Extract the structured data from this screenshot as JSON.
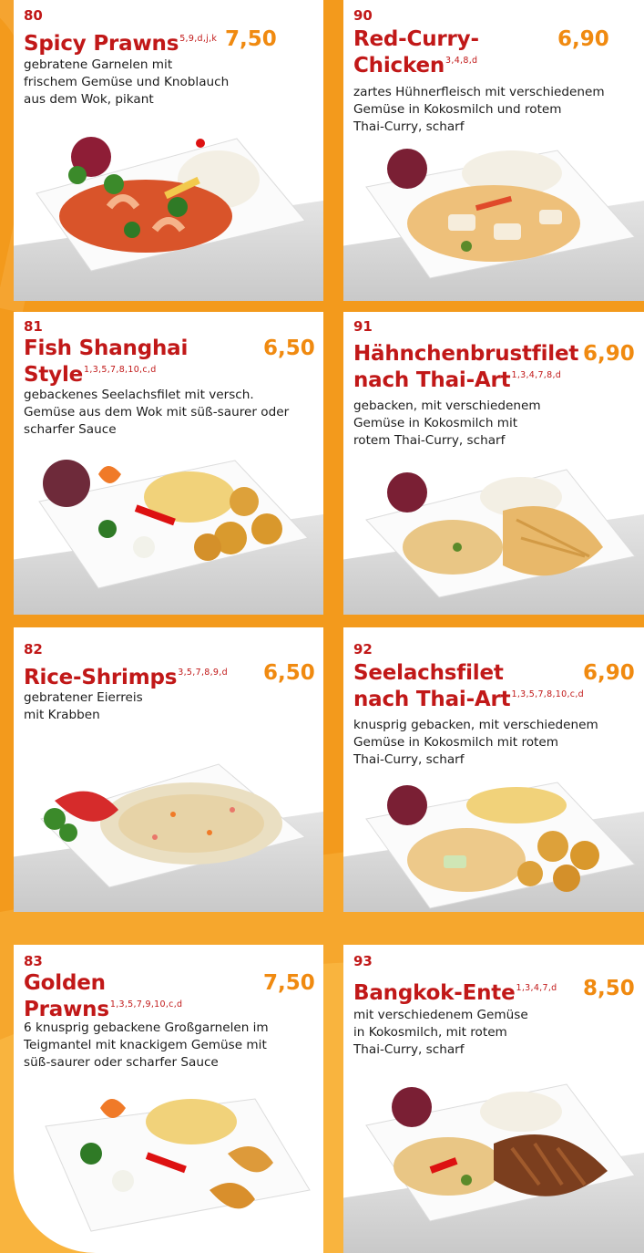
{
  "theme": {
    "background": "#f39a1c",
    "card": "#ffffff",
    "title_color": "#c11818",
    "price_color": "#f08a10",
    "text_color": "#1c1c1c"
  },
  "items": [
    {
      "number": "80",
      "title_lines": [
        "Spicy Prawns"
      ],
      "allergens": "5,9,d,j,k",
      "price": "7,50",
      "description_lines": [
        "gebratene Garnelen mit",
        "frischem Gemüse und Knoblauch",
        "aus dem Wok, pikant"
      ],
      "dish_icon": "prawn-dish-icon"
    },
    {
      "number": "81",
      "title_lines": [
        "Fish Shanghai",
        "Style"
      ],
      "allergens": "1,3,5,7,8,10,c,d",
      "price": "6,50",
      "description_lines": [
        "gebackenes Seelachsfilet mit versch.",
        "Gemüse aus dem Wok mit süß-saurer oder",
        "scharfer Sauce"
      ],
      "dish_icon": "fish-dish-icon"
    },
    {
      "number": "82",
      "title_lines": [
        "Rice-Shrimps"
      ],
      "allergens": "3,5,7,8,9,d",
      "price": "6,50",
      "description_lines": [
        "gebratener Eierreis",
        "mit Krabben"
      ],
      "dish_icon": "fried-rice-dish-icon"
    },
    {
      "number": "83",
      "title_lines": [
        "Golden",
        "Prawns"
      ],
      "allergens": "1,3,5,7,9,10,c,d",
      "price": "7,50",
      "description_lines": [
        "6 knusprig gebackene Großgarnelen im",
        "Teigmantel mit knackigem Gemüse mit",
        "süß-saurer oder scharfer Sauce"
      ],
      "dish_icon": "golden-prawns-dish-icon"
    },
    {
      "number": "90",
      "title_lines": [
        "Red-Curry-",
        "Chicken"
      ],
      "allergens": "3,4,8,d",
      "price": "6,90",
      "description_lines": [
        "zartes Hühnerfleisch mit verschiedenem",
        "Gemüse in Kokosmilch und rotem",
        "Thai-Curry, scharf"
      ],
      "dish_icon": "curry-chicken-dish-icon"
    },
    {
      "number": "91",
      "title_lines": [
        "Hähnchenbrustfilet",
        "nach Thai-Art"
      ],
      "allergens": "1,3,4,7,8,d",
      "price": "6,90",
      "description_lines": [
        "gebacken, mit verschiedenem",
        "Gemüse in Kokosmilch mit",
        "rotem Thai-Curry, scharf"
      ],
      "dish_icon": "chicken-breast-dish-icon"
    },
    {
      "number": "92",
      "title_lines": [
        "Seelachsfilet",
        "nach Thai-Art"
      ],
      "allergens": "1,3,5,7,8,10,c,d",
      "price": "6,90",
      "description_lines": [
        "knusprig gebacken, mit verschiedenem",
        "Gemüse in Kokosmilch mit rotem",
        "Thai-Curry, scharf"
      ],
      "dish_icon": "fish-curry-dish-icon"
    },
    {
      "number": "93",
      "title_lines": [
        "Bangkok-Ente"
      ],
      "allergens": "1,3,4,7,d",
      "price": "8,50",
      "description_lines": [
        "mit verschiedenem Gemüse",
        "in Kokosmilch, mit rotem",
        "Thai-Curry, scharf"
      ],
      "dish_icon": "duck-dish-icon"
    }
  ]
}
